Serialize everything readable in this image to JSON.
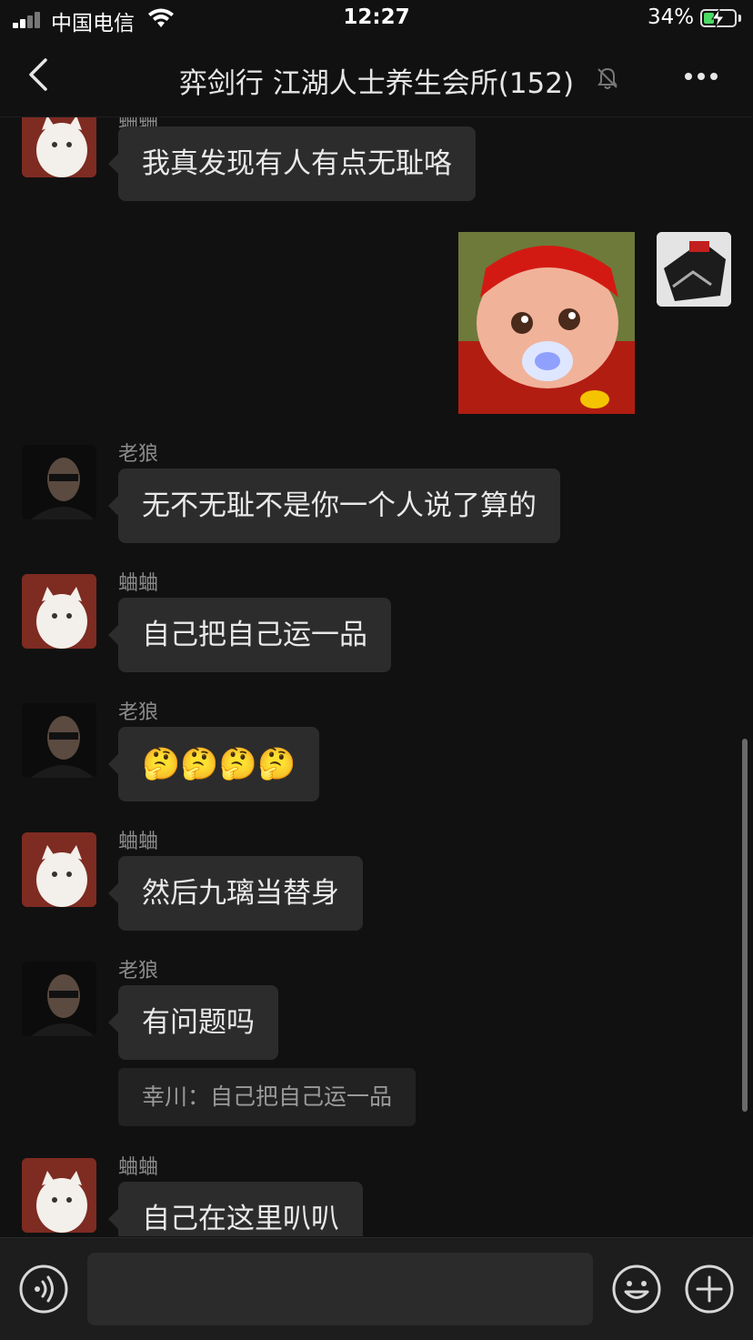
{
  "status": {
    "carrier": "中国电信",
    "time": "12:27",
    "battery": "34%",
    "battery_level": 0.34
  },
  "header": {
    "title": "弈剑行 江湖人士养生会所(152)",
    "back_icon": "chevron-left-icon",
    "mute_icon": "bell-off-icon",
    "more_icon": "more-dots-icon"
  },
  "messages": [
    {
      "sender": "蛐蛐",
      "text": "我真发现有人有点无耻咯"
    },
    {
      "sender": "",
      "type": "sticker",
      "description": "pig-sticker"
    },
    {
      "sender": "老狼",
      "text": "无不无耻不是你一个人说了算的"
    },
    {
      "sender": "蛐蛐",
      "text": "自己把自己运一品"
    },
    {
      "sender": "老狼",
      "text": "🤔🤔🤔🤔"
    },
    {
      "sender": "蛐蛐",
      "text": "然后九璃当替身"
    },
    {
      "sender": "老狼",
      "text": "有问题吗",
      "quote": "幸川：自己把自己运一品"
    },
    {
      "sender": "蛐蛐",
      "text": "自己在这里叭叭"
    }
  ],
  "input": {
    "placeholder": "",
    "voice_icon": "voice-icon",
    "emoji_icon": "emoji-icon",
    "plus_icon": "plus-icon"
  },
  "colors": {
    "background": "#111111",
    "bubble": "#2c2c2c",
    "battery_green": "#4cd964"
  }
}
